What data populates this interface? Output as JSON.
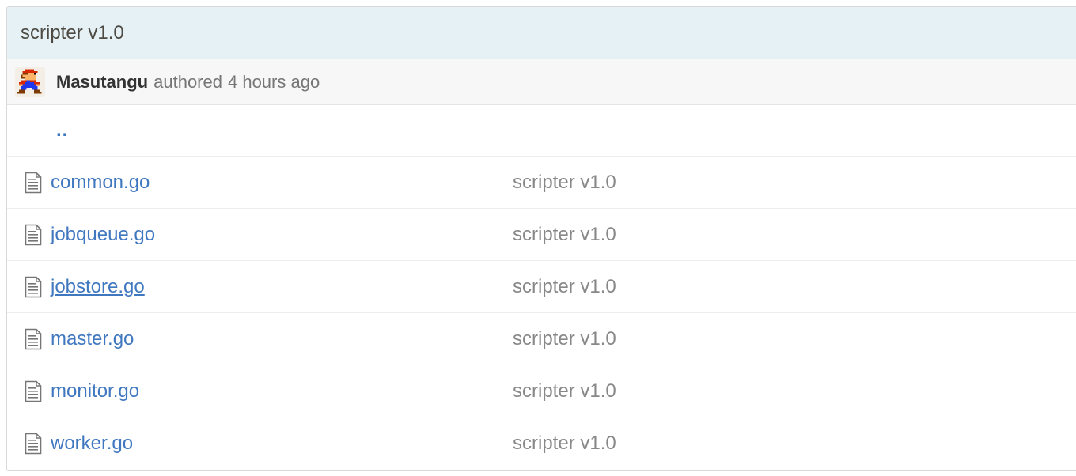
{
  "commit": {
    "title": "scripter v1.0",
    "author": "Masutangu",
    "authored_text": "authored",
    "time_ago": "4 hours ago"
  },
  "up_link": {
    "label": ".."
  },
  "files": [
    {
      "name": "common.go",
      "message": "scripter v1.0"
    },
    {
      "name": "jobqueue.go",
      "message": "scripter v1.0"
    },
    {
      "name": "jobstore.go",
      "message": "scripter v1.0"
    },
    {
      "name": "master.go",
      "message": "scripter v1.0"
    },
    {
      "name": "monitor.go",
      "message": "scripter v1.0"
    },
    {
      "name": "worker.go",
      "message": "scripter v1.0"
    }
  ],
  "icons": {
    "file": "file-text-icon",
    "avatar": "pixel-mario-avatar"
  },
  "colors": {
    "link": "#4078c0",
    "header_bg": "#e6f1f6",
    "meta_bg": "#f7f7f7",
    "muted_text": "#888888"
  }
}
